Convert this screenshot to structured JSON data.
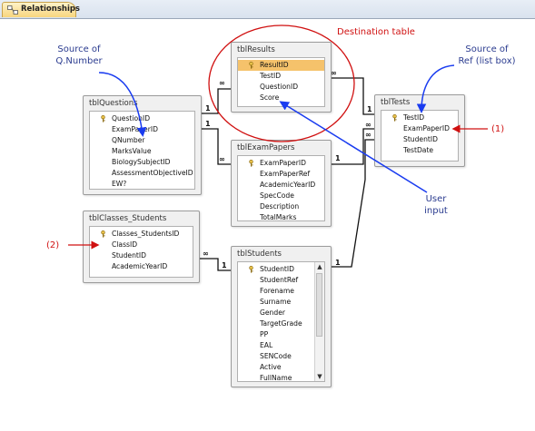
{
  "window": {
    "tab_label": "Relationships",
    "tab_icon": "relationships-icon"
  },
  "tables": {
    "tblResults": {
      "title": "tblResults",
      "fields": [
        "ResultID",
        "TestID",
        "QuestionID",
        "Score"
      ],
      "key_field": "ResultID",
      "selected_field": "ResultID"
    },
    "tblQuestions": {
      "title": "tblQuestions",
      "fields": [
        "QuestionID",
        "ExamPaperID",
        "QNumber",
        "MarksValue",
        "BiologySubjectID",
        "AssessmentObjectiveID",
        "EW?"
      ],
      "key_field": "QuestionID"
    },
    "tblTests": {
      "title": "tblTests",
      "fields": [
        "TestID",
        "ExamPaperID",
        "StudentID",
        "TestDate"
      ],
      "key_field": "TestID"
    },
    "tblExamPapers": {
      "title": "tblExamPapers",
      "fields": [
        "ExamPaperID",
        "ExamPaperRef",
        "AcademicYearID",
        "SpecCode",
        "Description",
        "TotalMarks"
      ],
      "key_field": "ExamPaperID"
    },
    "tblClasses_Students": {
      "title": "tblClasses_Students",
      "fields": [
        "Classes_StudentsID",
        "ClassID",
        "StudentID",
        "AcademicYearID"
      ],
      "key_field": "Classes_StudentsID"
    },
    "tblStudents": {
      "title": "tblStudents",
      "fields": [
        "StudentID",
        "StudentRef",
        "Forename",
        "Surname",
        "Gender",
        "TargetGrade",
        "PP",
        "EAL",
        "SENCode",
        "Active",
        "FullName"
      ],
      "key_field": "StudentID",
      "has_scrollbar": true
    }
  },
  "relationship_labels": {
    "one": "1",
    "many": "∞"
  },
  "annotations": {
    "destination": "Destination table",
    "source_qnumber": [
      "Source of",
      "Q.Number"
    ],
    "source_ref": [
      "Source of",
      "Ref (list box)"
    ],
    "user_input": [
      "User",
      "input"
    ],
    "marker_1": "(1)",
    "marker_2": "(2)"
  },
  "colors": {
    "annotation_blue": "#2a3b8f",
    "arrow_blue": "#1a3cf0",
    "annotation_red": "#d01010",
    "selected_field": "#f5c26b",
    "tab_gold": "#f7d57e"
  }
}
